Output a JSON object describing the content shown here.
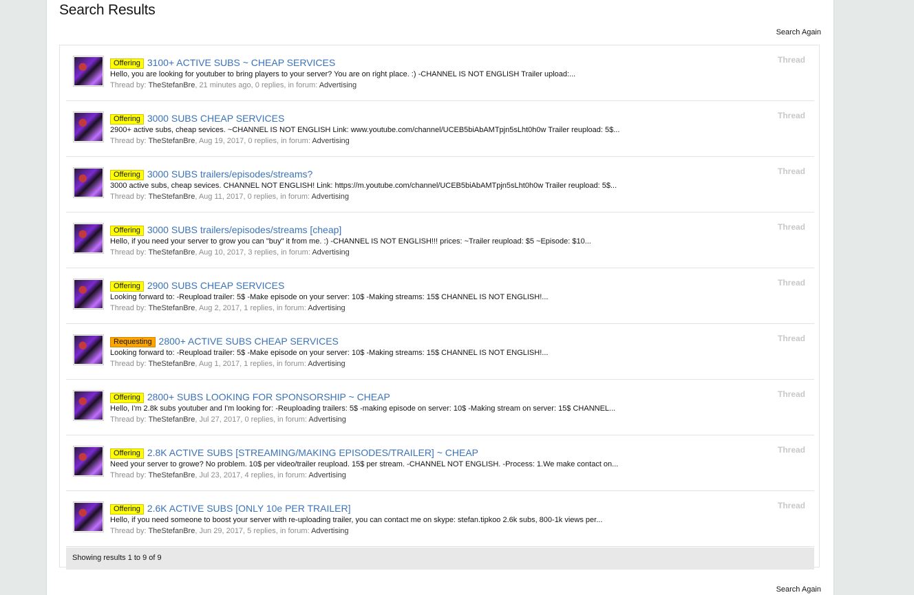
{
  "page": {
    "title": "Search Results",
    "search_again_label": "Search Again"
  },
  "results": [
    {
      "prefix": "Offering",
      "title": "3100+ ACTIVE SUBS ~ CHEAP SERVICES",
      "snippet": "Hello, you are looking for youtuber to bring players to your server? You are on right place. :) -CHANNEL IS NOT ENGLISH Trailer upload:...",
      "meta_prefix": "Thread by: ",
      "author": "TheStefanBre",
      "meta_details": ", 21 minutes ago, 0 replies, in forum: ",
      "forum": "Advertising",
      "type": "Thread"
    },
    {
      "prefix": "Offering",
      "title": "3000 SUBS CHEAP SERVICES",
      "snippet": "2900+ active subs, cheap sevices. ~CHANNEL IS NOT ENGLISH Link: www.youtube.com/channel/UCEB5biAbAMTpjn5sLht0h0w Trailer reupload: 5$...",
      "meta_prefix": "Thread by: ",
      "author": "TheStefanBre",
      "meta_details": ", Aug 19, 2017, 0 replies, in forum: ",
      "forum": "Advertising",
      "type": "Thread"
    },
    {
      "prefix": "Offering",
      "title": "3000 SUBS trailers/episodes/streams?",
      "snippet": "3000 active subs, cheap sevices. CHANNEL NOT ENGLISH! Link: https://m.youtube.com/channel/UCEB5biAbAMTpjn5sLht0h0w Trailer reupload: 5$...",
      "meta_prefix": "Thread by: ",
      "author": "TheStefanBre",
      "meta_details": ", Aug 11, 2017, 0 replies, in forum: ",
      "forum": "Advertising",
      "type": "Thread"
    },
    {
      "prefix": "Offering",
      "title": "3000 SUBS trailers/episodes/streams [cheap]",
      "snippet": "Hello, if you need your server to grow you can \"buy\" it from me. :) -CHANNEL IS NOT ENGLISH!!! prices: ~Trailer reupload: $5 ~Episode: $10...",
      "meta_prefix": "Thread by: ",
      "author": "TheStefanBre",
      "meta_details": ", Aug 10, 2017, 3 replies, in forum: ",
      "forum": "Advertising",
      "type": "Thread"
    },
    {
      "prefix": "Offering",
      "title": "2900 SUBS CHEAP SERVICES",
      "snippet": "Looking forward to: -Reupload trailer: 5$ -Make episode on your server: 10$ -Making streams: 15$ CHANNEL IS NOT ENGLISH!...",
      "meta_prefix": "Thread by: ",
      "author": "TheStefanBre",
      "meta_details": ", Aug 2, 2017, 1 replies, in forum: ",
      "forum": "Advertising",
      "type": "Thread"
    },
    {
      "prefix": "Requesting",
      "title": "2800+ ACTIVE SUBS CHEAP SERVICES",
      "snippet": "Looking forward to: -Reupload trailer: 5$ -Make episode on your server: 10$ -Making streams: 15$ CHANNEL IS NOT ENGLISH!...",
      "meta_prefix": "Thread by: ",
      "author": "TheStefanBre",
      "meta_details": ", Aug 1, 2017, 1 replies, in forum: ",
      "forum": "Advertising",
      "type": "Thread"
    },
    {
      "prefix": "Offering",
      "title": "2800+ SUBS LOOKING FOR SPONSORSHIP ~ CHEAP",
      "snippet": "Hello, I'm 2.8k subs youtuber and I'm looking for: -Reuploading trailers: 5$ -making episode on server: 10$ -Making stream on server: 15$ CHANNEL...",
      "meta_prefix": "Thread by: ",
      "author": "TheStefanBre",
      "meta_details": ", Jul 27, 2017, 0 replies, in forum: ",
      "forum": "Advertising",
      "type": "Thread"
    },
    {
      "prefix": "Offering",
      "title": "2.8K ACTIVE SUBS [STREAMING/MAKING EPISODES/TRAILER] ~ CHEAP",
      "snippet": "Need your server to growe? No problem. 10$ per video/trailer reupload. 15$ per stream. -CHANNEL NOT ENGLISH. -Process: 1.We make contact on...",
      "meta_prefix": "Thread by: ",
      "author": "TheStefanBre",
      "meta_details": ", Jul 23, 2017, 4 replies, in forum: ",
      "forum": "Advertising",
      "type": "Thread"
    },
    {
      "prefix": "Offering",
      "title": "2.6K ACTIVE SUBS [ONLY 10e PER TRAILER]",
      "snippet": "Hello, if you need someone to boost your server with re-uploading trailer, you can contact me on skype: stefan.tipkoo 2.6k subs, 800-1k views per...",
      "meta_prefix": "Thread by: ",
      "author": "TheStefanBre",
      "meta_details": ", Jun 29, 2017, 5 replies, in forum: ",
      "forum": "Advertising",
      "type": "Thread"
    }
  ],
  "footer": {
    "showing_text": "Showing results 1 to 9 of 9"
  },
  "colors": {
    "link": "#3b73b9",
    "offering_prefix": "#ffff00",
    "requesting_prefix": "#ffa500",
    "page_background": "#e5e9e8"
  }
}
